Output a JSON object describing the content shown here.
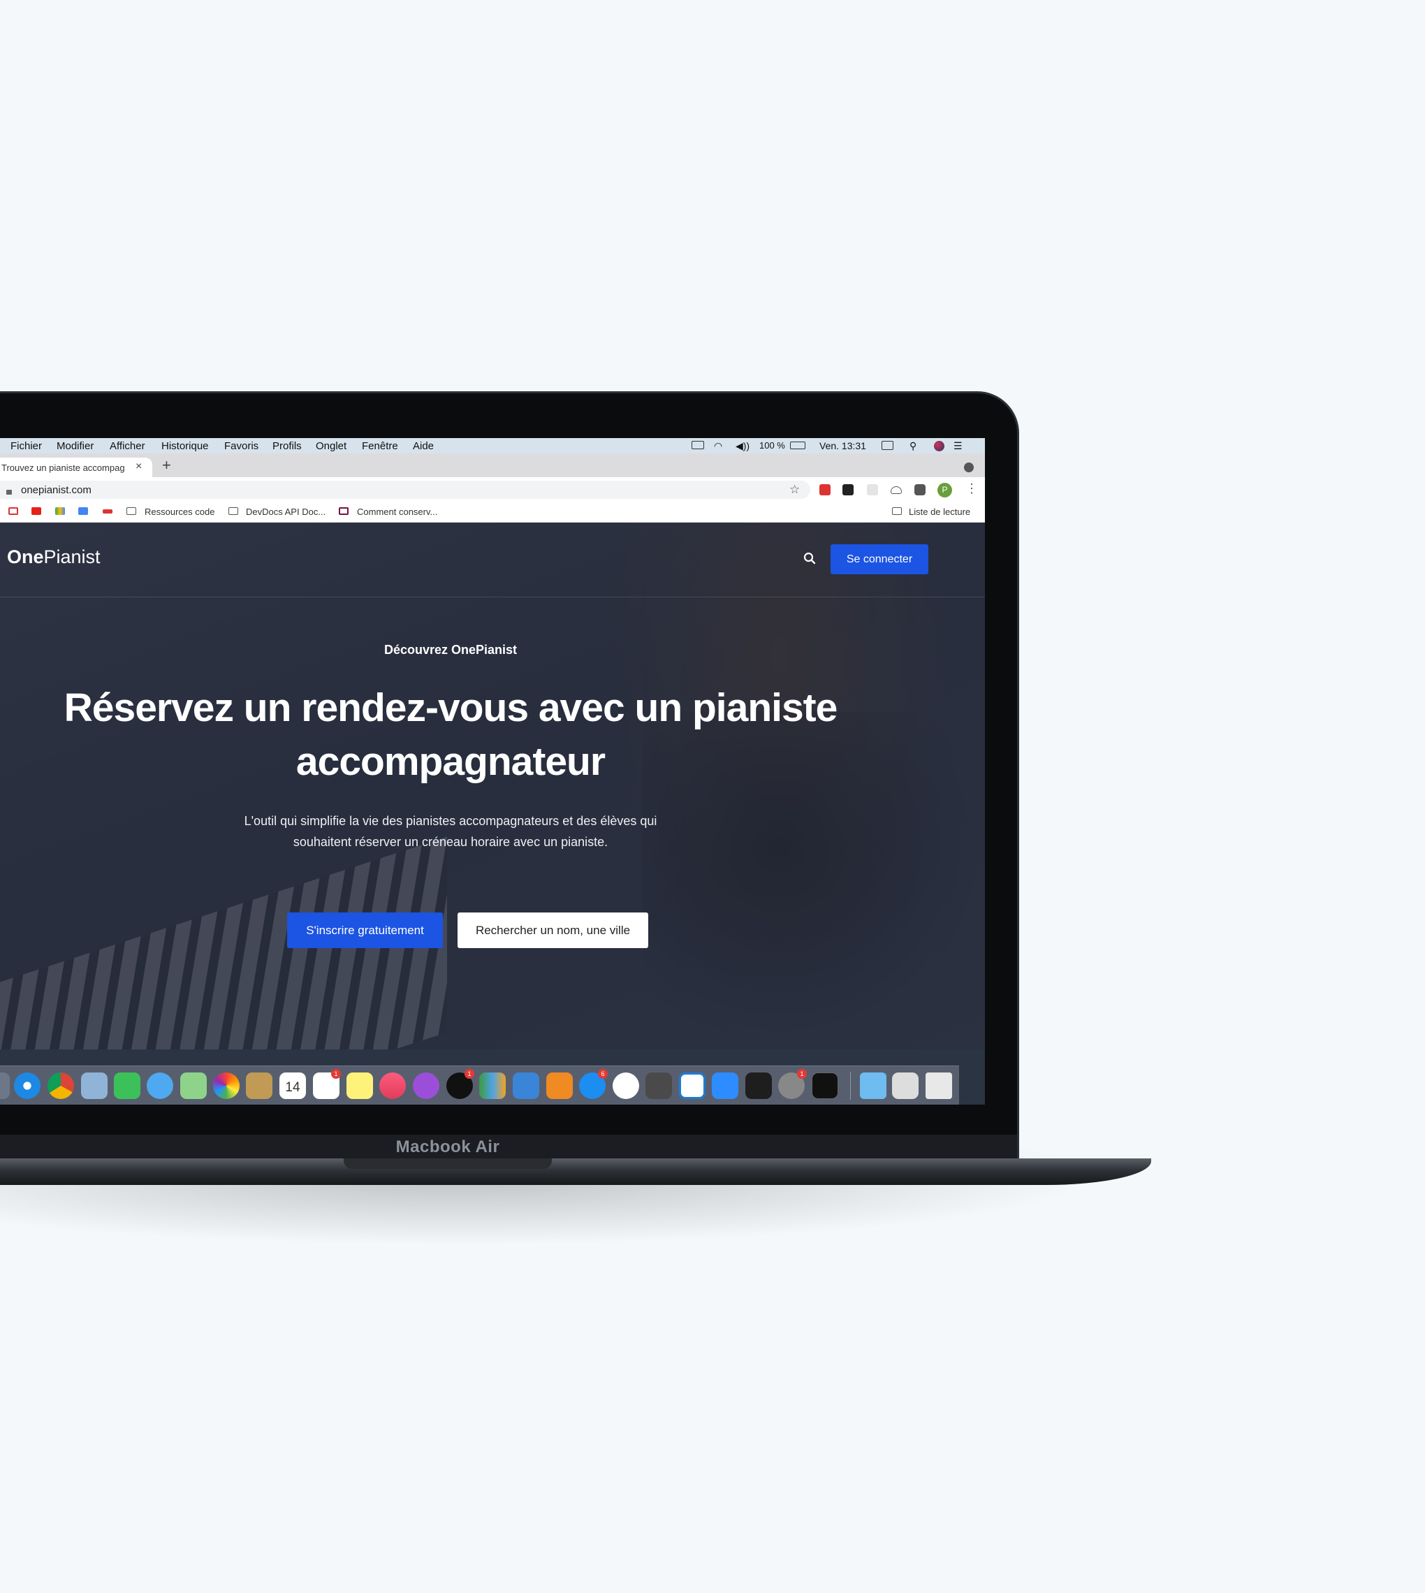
{
  "menubar": {
    "items": [
      "Fichier",
      "Modifier",
      "Afficher",
      "Historique",
      "Favoris",
      "Profils",
      "Onglet",
      "Fenêtre",
      "Aide"
    ],
    "battery": "100 %",
    "clock": "Ven. 13:31"
  },
  "browser": {
    "tab_title": "Trouvez un pianiste accompag",
    "tab_close": "×",
    "new_tab": "+",
    "url": "onepianist.com",
    "profile_initial": "P",
    "bookmarks": [
      "Ressources code",
      "DevDocs API Doc...",
      "Comment conserv..."
    ],
    "reading_list": "Liste de lecture"
  },
  "site": {
    "logo_bold": "One",
    "logo_light": "Pianist",
    "login_button": "Se connecter",
    "kicker": "Découvrez OnePianist",
    "title": "Réservez un rendez-vous avec un pianiste accompagnateur",
    "subtitle": "L'outil qui simplifie la vie des pianistes accompagnateurs et des élèves qui souhaitent réserver un créneau horaire avec un pianiste.",
    "cta_primary": "S'inscrire gratuitement",
    "cta_secondary": "Rechercher un nom, une ville"
  },
  "dock": {
    "calendar_day": "14",
    "apps": [
      "finder-partial",
      "safari",
      "chrome",
      "preview",
      "facetime",
      "messages",
      "maps",
      "photos",
      "contacts",
      "calendar",
      "reminders",
      "notes",
      "music",
      "podcasts",
      "apple-tv",
      "numbers",
      "keynote",
      "pages",
      "app-store",
      "slack",
      "sublime-text",
      "vscode",
      "zoom",
      "figma",
      "system-preferences",
      "terminal",
      "folder",
      "clipboard",
      "trash"
    ],
    "badges": [
      "1",
      "1",
      "6",
      "1"
    ]
  },
  "laptop_label": "Macbook Air",
  "colors": {
    "accent": "#1c54e3",
    "background": "#f5f8fb"
  }
}
